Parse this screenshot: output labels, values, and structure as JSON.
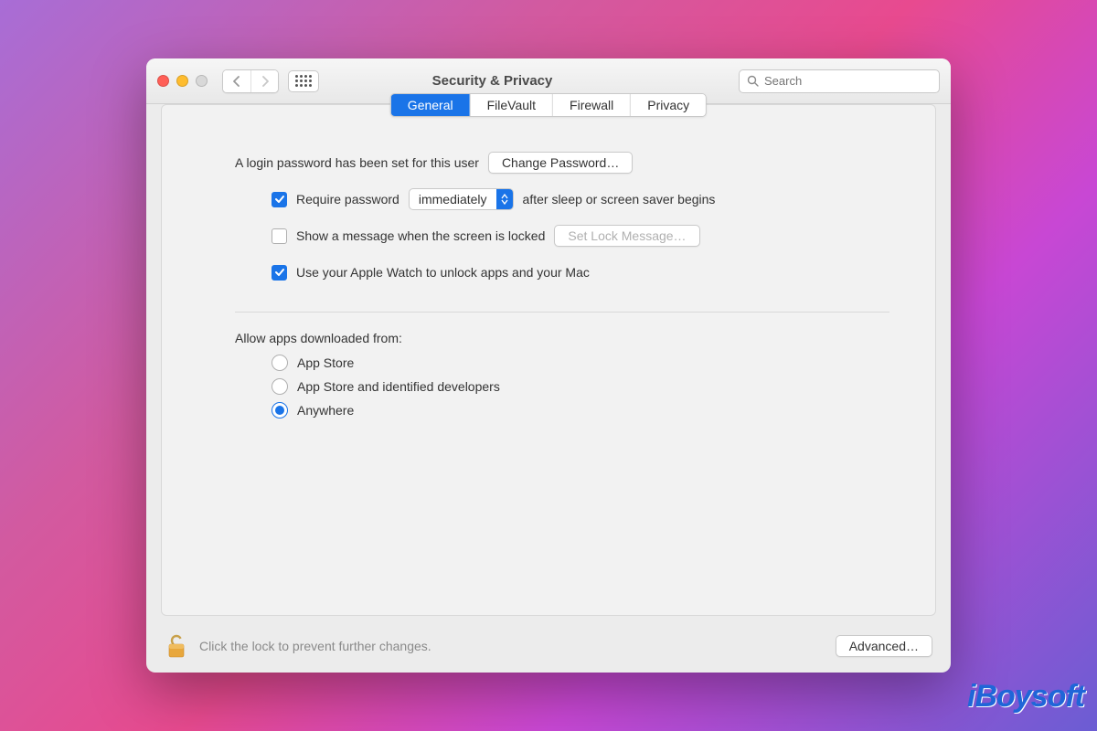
{
  "window": {
    "title": "Security & Privacy"
  },
  "search": {
    "placeholder": "Search"
  },
  "tabs": [
    "General",
    "FileVault",
    "Firewall",
    "Privacy"
  ],
  "active_tab": 0,
  "login_password": {
    "text": "A login password has been set for this user",
    "button": "Change Password…"
  },
  "require_password": {
    "checked": true,
    "label_before": "Require password",
    "select_value": "immediately",
    "label_after": "after sleep or screen saver begins"
  },
  "show_message": {
    "checked": false,
    "label": "Show a message when the screen is locked",
    "button": "Set Lock Message…",
    "button_enabled": false
  },
  "apple_watch": {
    "checked": true,
    "label": "Use your Apple Watch to unlock apps and your Mac"
  },
  "allow_apps": {
    "heading": "Allow apps downloaded from:",
    "options": [
      "App Store",
      "App Store and identified developers",
      "Anywhere"
    ],
    "selected": 2
  },
  "footer": {
    "lock_text": "Click the lock to prevent further changes.",
    "advanced": "Advanced…"
  },
  "watermark": "iBoysoft"
}
